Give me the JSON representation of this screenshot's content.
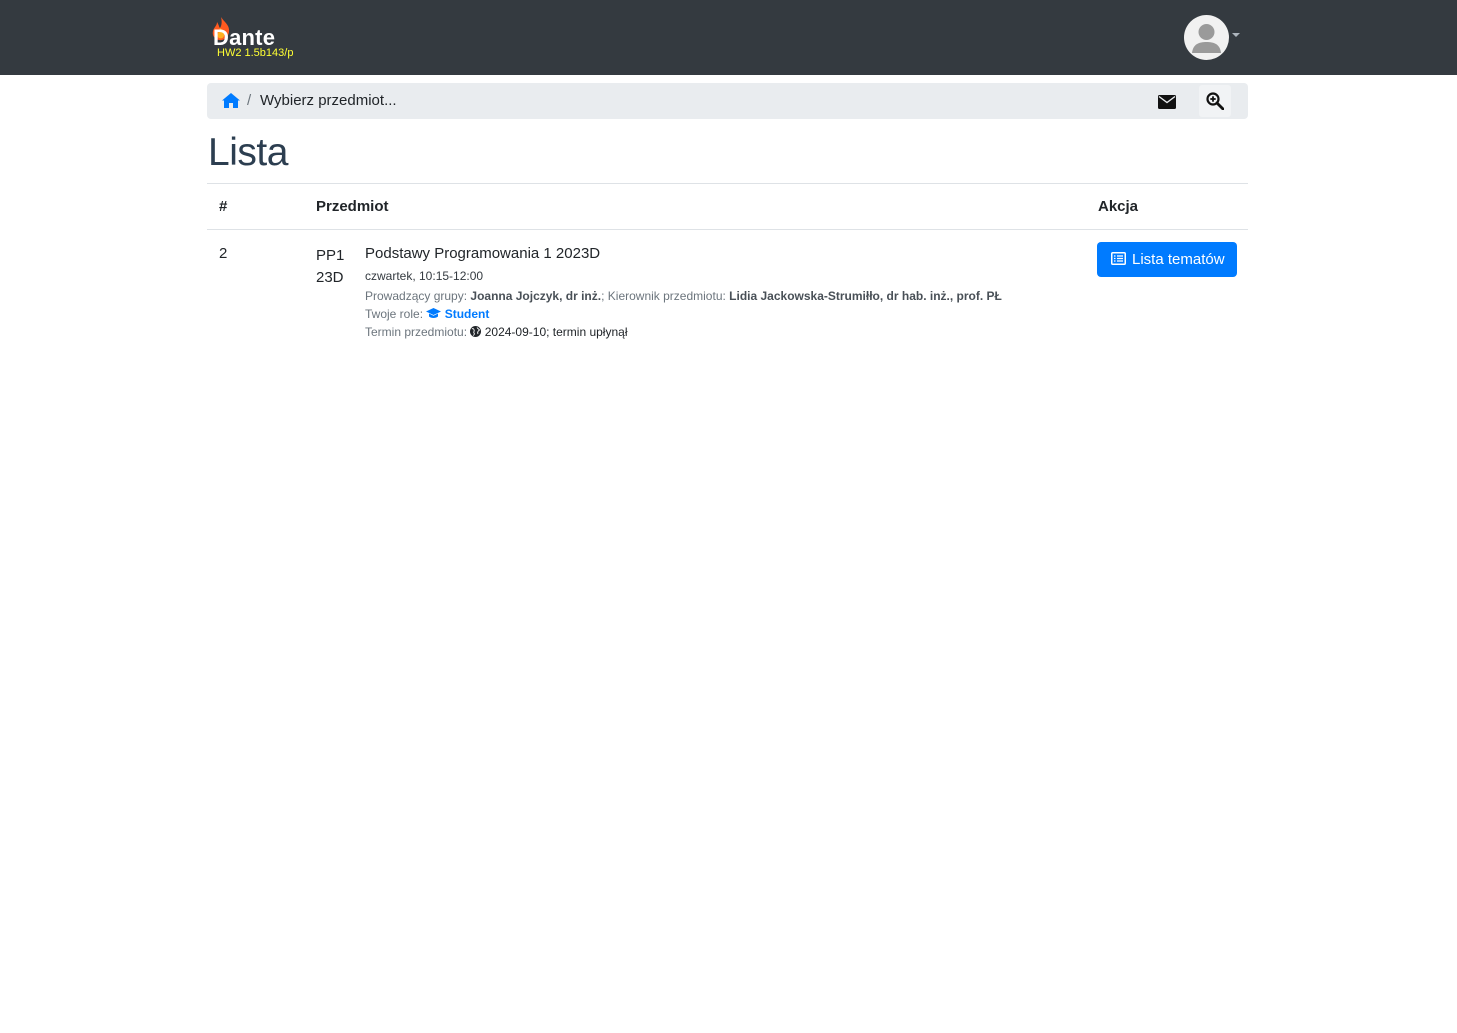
{
  "header": {
    "logo_text": "Dante",
    "version": "HW2 1.5b143/p"
  },
  "breadcrumb": {
    "separator": "/",
    "current": "Wybierz przedmiot..."
  },
  "page": {
    "title": "Lista"
  },
  "table": {
    "headers": [
      "#",
      "Przedmiot",
      "Akcja"
    ],
    "rows": [
      {
        "num": "2",
        "code_line1": "PP1",
        "code_line2": "23D",
        "name": "Podstawy Programowania 1 2023D",
        "schedule": "czwartek, 10:15-12:00",
        "lecturer_label": "Prowadzący grupy:",
        "lecturer": "Joanna Jojczyk, dr inż.",
        "manager_label": "; Kierownik przedmiotu:",
        "manager": "Lidia Jackowska-Strumiłło, dr hab. inż., prof. PŁ",
        "roles_label": "Twoje role:",
        "role": "Student",
        "term_label": "Termin przedmiotu:",
        "term_value": "2024-09-10; termin upłynął",
        "action_label": "Lista tematów"
      }
    ]
  },
  "colors": {
    "navbar": "#343a40",
    "primary": "#007bff",
    "version_text": "#ffff33"
  }
}
